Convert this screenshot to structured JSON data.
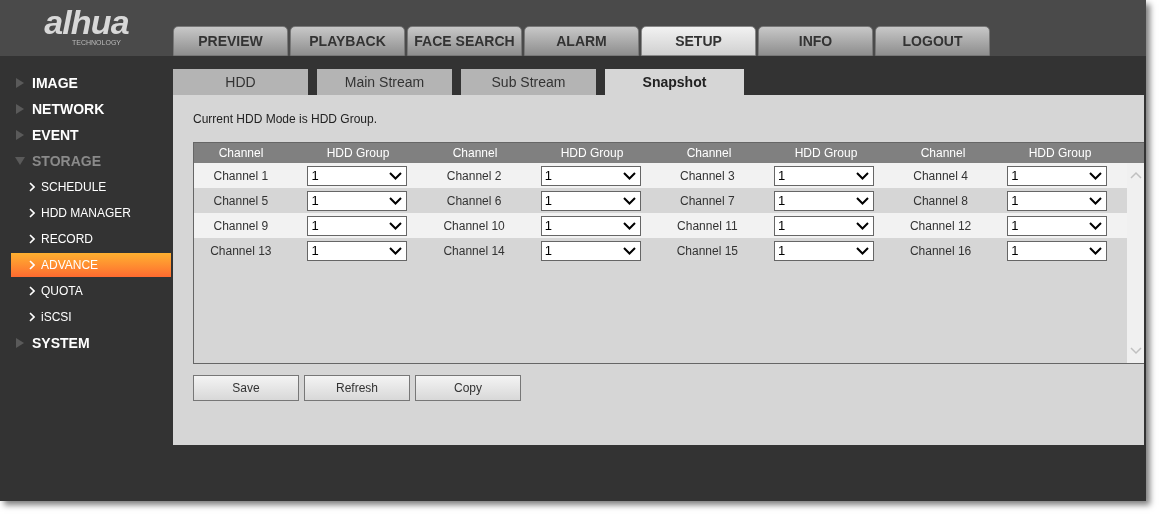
{
  "logo": {
    "wordmark": "alhua",
    "tagline": "TECHNOLOGY"
  },
  "top_tabs": [
    {
      "label": "PREVIEW",
      "selected": false
    },
    {
      "label": "PLAYBACK",
      "selected": false
    },
    {
      "label": "FACE SEARCH",
      "selected": false
    },
    {
      "label": "ALARM",
      "selected": false
    },
    {
      "label": "SETUP",
      "selected": true
    },
    {
      "label": "INFO",
      "selected": false
    },
    {
      "label": "LOGOUT",
      "selected": false
    }
  ],
  "sidebar": {
    "items": [
      {
        "label": "IMAGE",
        "expanded": false
      },
      {
        "label": "NETWORK",
        "expanded": false
      },
      {
        "label": "EVENT",
        "expanded": false
      },
      {
        "label": "STORAGE",
        "expanded": true,
        "children": [
          {
            "label": "SCHEDULE",
            "selected": false
          },
          {
            "label": "HDD MANAGER",
            "selected": false
          },
          {
            "label": "RECORD",
            "selected": false
          },
          {
            "label": "ADVANCE",
            "selected": true
          },
          {
            "label": "QUOTA",
            "selected": false
          },
          {
            "label": "iSCSI",
            "selected": false
          }
        ]
      },
      {
        "label": "SYSTEM",
        "expanded": false
      }
    ]
  },
  "sub_tabs": [
    {
      "label": "HDD",
      "selected": false
    },
    {
      "label": "Main Stream",
      "selected": false
    },
    {
      "label": "Sub Stream",
      "selected": false
    },
    {
      "label": "Snapshot",
      "selected": true
    }
  ],
  "message": "Current HDD Mode is HDD Group.",
  "table": {
    "columns": [
      "Channel",
      "HDD Group",
      "Channel",
      "HDD Group",
      "Channel",
      "HDD Group",
      "Channel",
      "HDD Group"
    ],
    "rows": [
      [
        "Channel 1",
        "1",
        "Channel 2",
        "1",
        "Channel 3",
        "1",
        "Channel 4",
        "1"
      ],
      [
        "Channel 5",
        "1",
        "Channel 6",
        "1",
        "Channel 7",
        "1",
        "Channel 8",
        "1"
      ],
      [
        "Channel 9",
        "1",
        "Channel 10",
        "1",
        "Channel 11",
        "1",
        "Channel 12",
        "1"
      ],
      [
        "Channel 13",
        "1",
        "Channel 14",
        "1",
        "Channel 15",
        "1",
        "Channel 16",
        "1"
      ]
    ]
  },
  "buttons": [
    "Save",
    "Refresh",
    "Copy"
  ]
}
